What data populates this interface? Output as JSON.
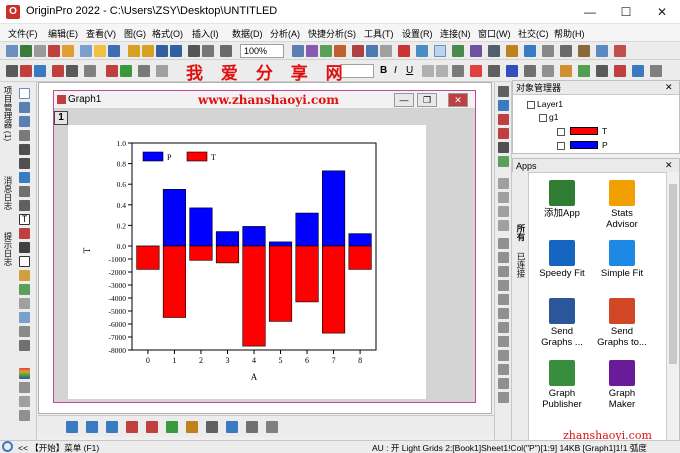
{
  "window": {
    "title": "OriginPro 2022 - C:\\Users\\ZSY\\Desktop\\UNTITLED",
    "minimize": "—",
    "maximize": "☐",
    "close": "✕"
  },
  "menu": [
    "文件(F)",
    "编辑(E)",
    "查看(V)",
    "图(G)",
    "格式(O)",
    "插入(I)",
    "数据(D)",
    "分析(A)",
    "快捷分析(S)",
    "工具(T)",
    "设置(R)",
    "连接(N)",
    "窗口(W)",
    "社交(C)",
    "帮助(H)"
  ],
  "toolbar": {
    "zoom": "100%"
  },
  "watermark": {
    "cn": "我 爱 分 享 网",
    "url": "www.zhanshaoyi.com",
    "url2": "zhanshaoyi.com"
  },
  "left_tabs": {
    "project": "项目管理器 (1)",
    "messages": "消息日志",
    "hints": "提示日志"
  },
  "graph_window": {
    "title": "Graph1",
    "layer": "1",
    "min": "—",
    "max": "❐",
    "close": "✕"
  },
  "object_manager": {
    "title": "对象管理器",
    "layer": "Layer1",
    "group": "g1",
    "items": [
      "T",
      "P"
    ]
  },
  "apps": {
    "title": "Apps",
    "tabs": [
      "所有",
      "已连接"
    ],
    "items": [
      {
        "label": "添加App"
      },
      {
        "label": "Stats\nAdvisor"
      },
      {
        "label": "Speedy Fit"
      },
      {
        "label": "Simple Fit"
      },
      {
        "label": "Send\nGraphs ..."
      },
      {
        "label": "Send\nGraphs to..."
      },
      {
        "label": "Graph\nPublisher"
      },
      {
        "label": "Graph\nMaker"
      }
    ]
  },
  "status": {
    "left": "<<  【开始】菜单 (F1)",
    "right": "AU : 开  Light Grids  2:[Book1]Sheet1!Col(\"P\")[1:9]  14KB  [Graph1]1!1  弧度"
  },
  "colors": {
    "P": "#0000ff",
    "T": "#ff0000",
    "window_accent": "#c24a9e"
  },
  "chart_data": {
    "type": "bar",
    "xlabel": "A",
    "ylabel": "T",
    "categories": [
      "0",
      "1",
      "2",
      "3",
      "4",
      "5",
      "6",
      "7",
      "8"
    ],
    "series": [
      {
        "name": "P",
        "values": [
          0.0,
          0.55,
          0.37,
          0.14,
          0.19,
          0.04,
          0.32,
          0.73,
          0.12
        ]
      },
      {
        "name": "T",
        "values": [
          -1800,
          -5500,
          -1100,
          -1300,
          -7700,
          -5800,
          -4300,
          -6700,
          -1800
        ]
      }
    ],
    "y_top_ticks": [
      "1.0",
      "0.8",
      "0.6",
      "0.4",
      "0.2",
      "0.0"
    ],
    "y_bottom_ticks": [
      "-1000",
      "-2000",
      "-3000",
      "-4000",
      "-5000",
      "-6000",
      "-7000",
      "-8000"
    ],
    "y_top_range": [
      0,
      1.0
    ],
    "y_bottom_range": [
      -8000,
      0
    ],
    "legend": "top-left",
    "grid": false
  }
}
